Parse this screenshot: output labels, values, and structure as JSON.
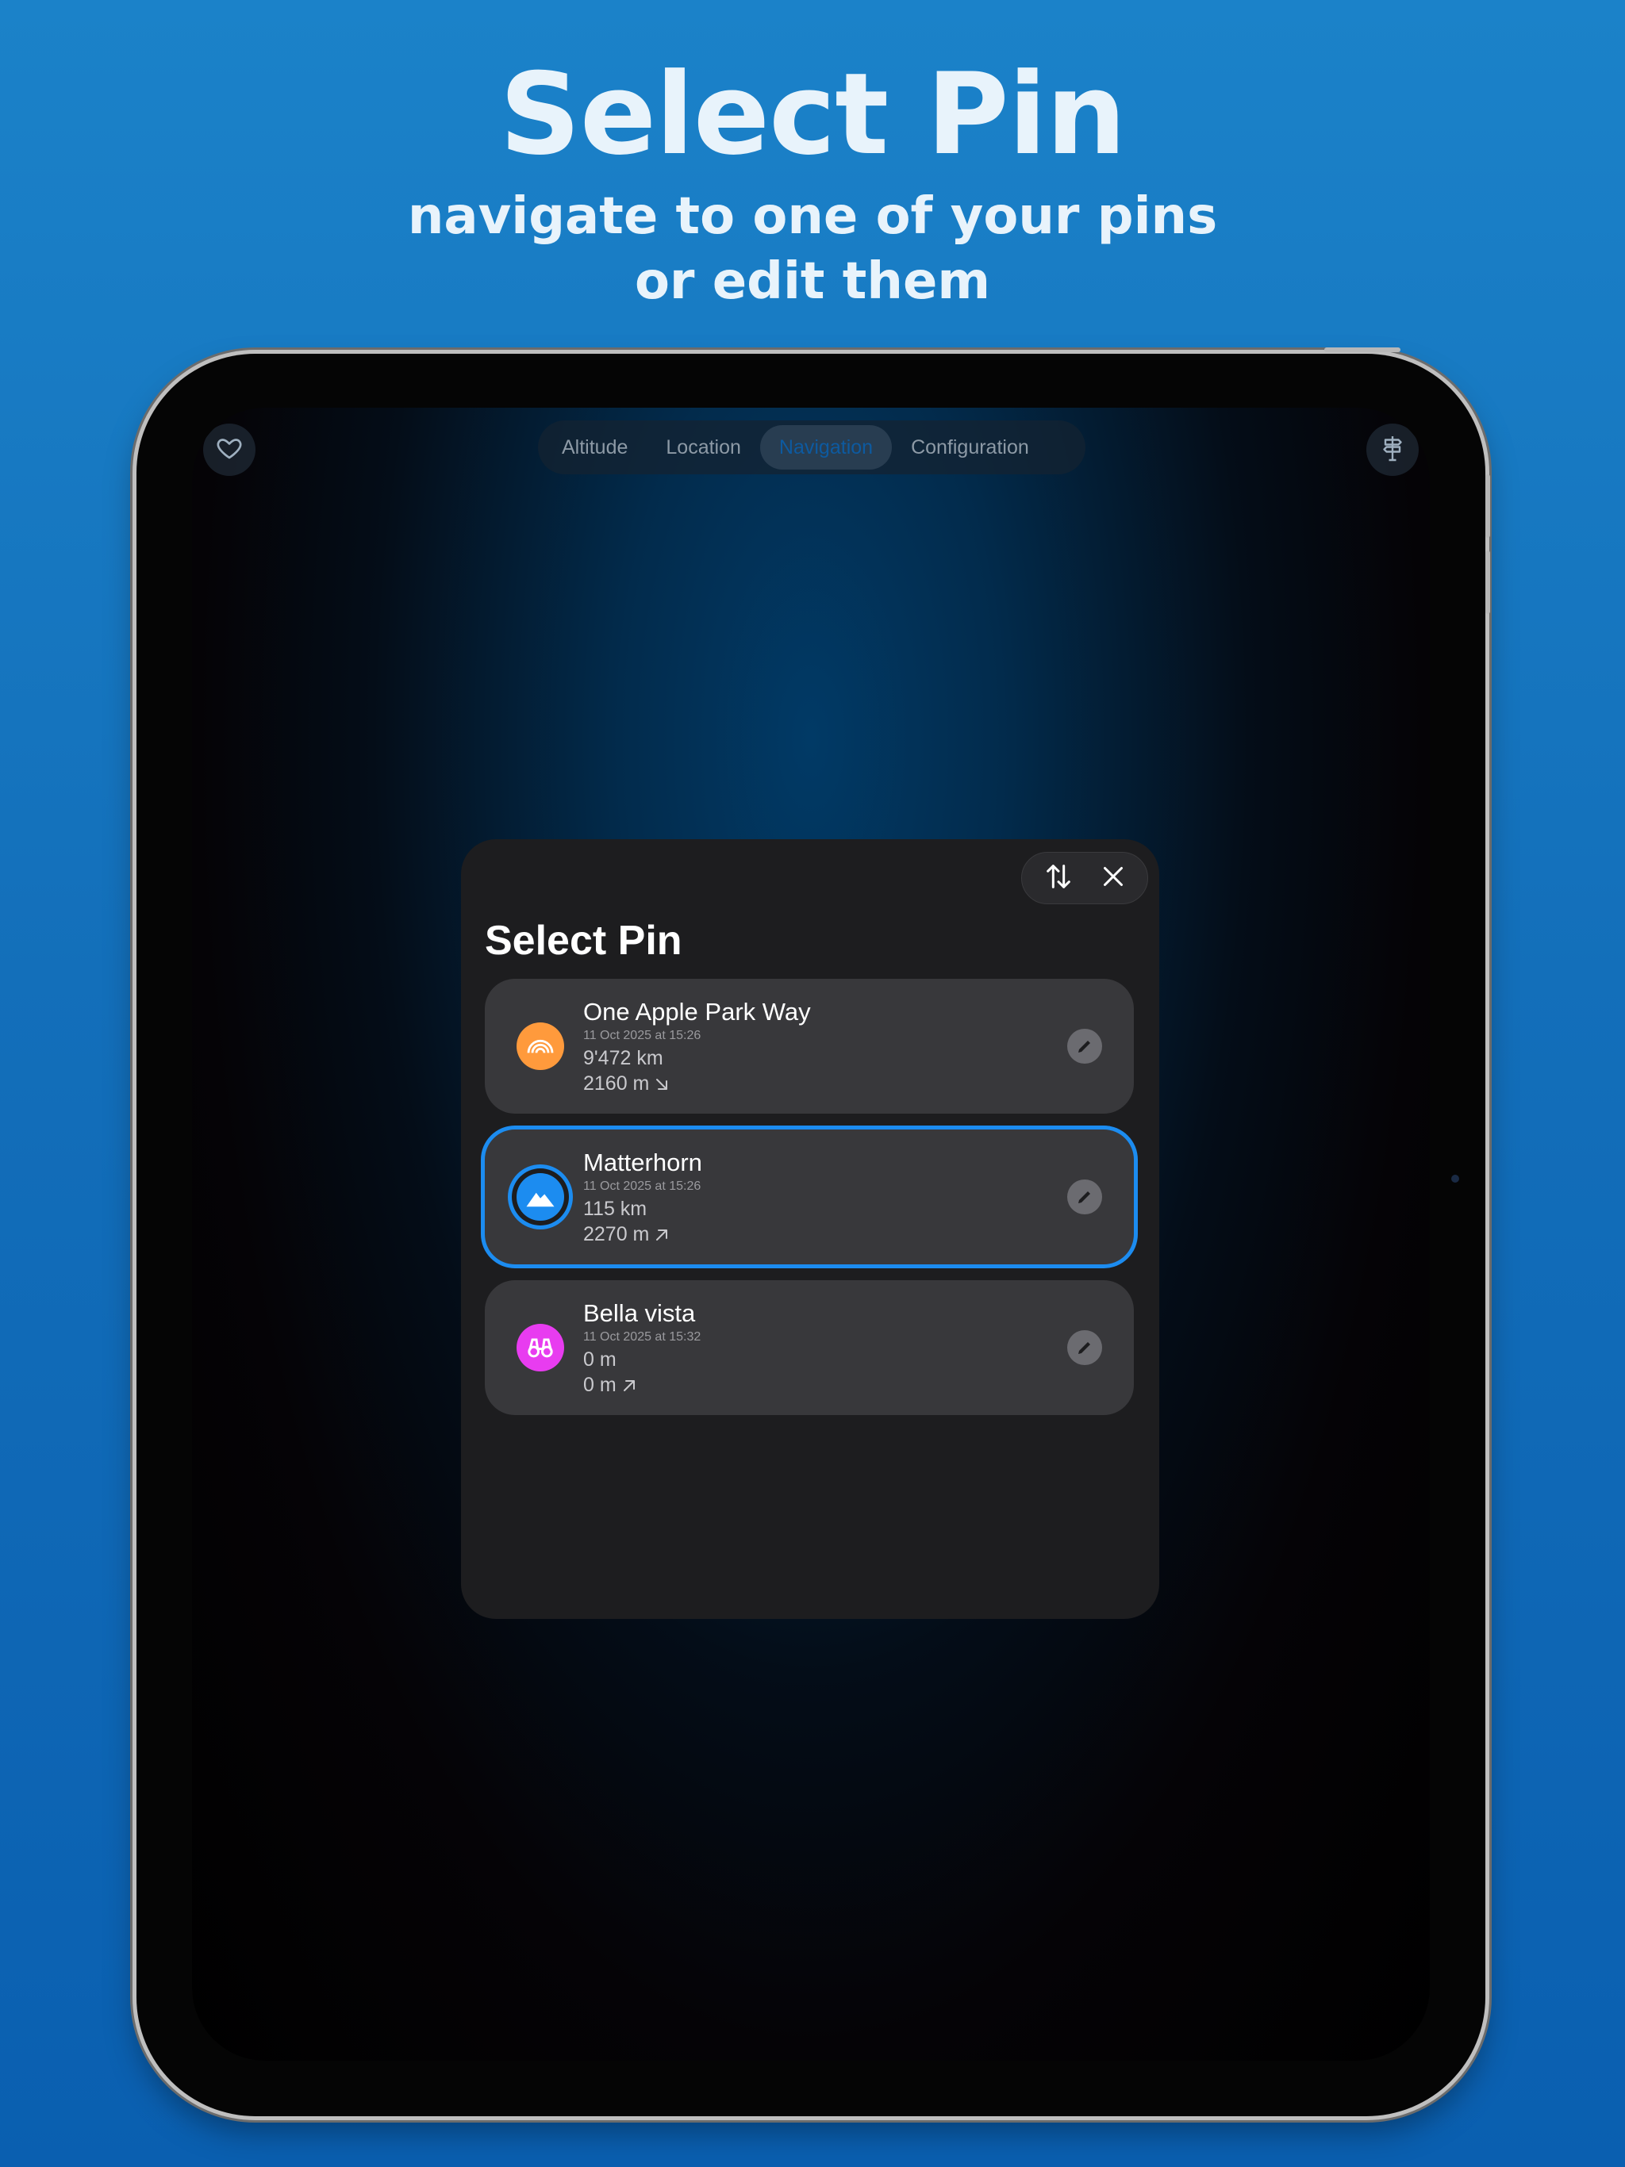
{
  "headline": {
    "title": "Select Pin",
    "subtitle_line1": "navigate to one of your pins",
    "subtitle_line2": "or edit them"
  },
  "topbar": {
    "left_icon": "heart-icon",
    "right_icon": "signpost-icon",
    "tabs": [
      {
        "label": "Altitude",
        "active": false
      },
      {
        "label": "Location",
        "active": false
      },
      {
        "label": "Navigation",
        "active": true
      },
      {
        "label": "Configuration",
        "active": false
      }
    ]
  },
  "sheet": {
    "title": "Select Pin",
    "sort_icon": "sort-arrows-icon",
    "close_icon": "close-icon",
    "pins": [
      {
        "name": "One Apple Park Way",
        "date": "11 Oct 2025 at 15:26",
        "distance": "9'472 km",
        "altitude": "2160 m",
        "altitude_direction": "down",
        "icon": "rainbow-icon",
        "icon_color": "#ff9a3c",
        "selected": false
      },
      {
        "name": "Matterhorn",
        "date": "11 Oct 2025 at 15:26",
        "distance": "115 km",
        "altitude": "2270 m",
        "altitude_direction": "up",
        "icon": "mountain-icon",
        "icon_color": "#1c8cf0",
        "selected": true
      },
      {
        "name": "Bella vista",
        "date": "11 Oct 2025 at 15:32",
        "distance": "0 m",
        "altitude": "0 m",
        "altitude_direction": "up",
        "icon": "binoculars-icon",
        "icon_color": "#e83cf0",
        "selected": false
      }
    ]
  },
  "colors": {
    "accent": "#1c8cf0",
    "background": "#136fba"
  }
}
